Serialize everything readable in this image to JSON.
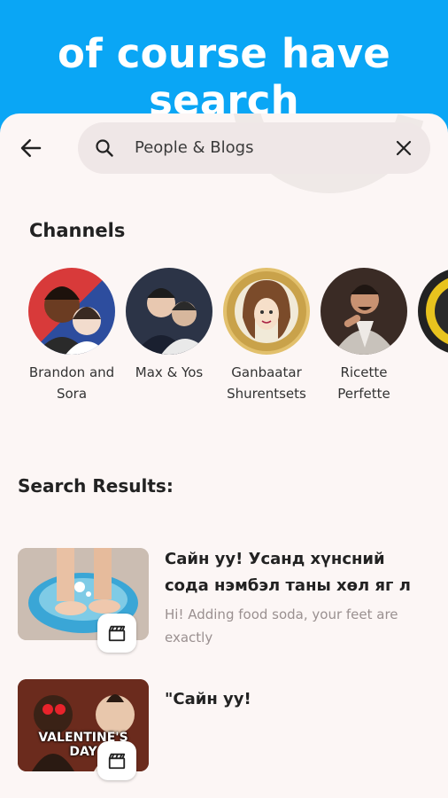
{
  "banner": {
    "title": "of course have search"
  },
  "search": {
    "query": "People & Blogs"
  },
  "channels": {
    "heading": "Channels",
    "items": [
      {
        "name": "Brandon and Sora"
      },
      {
        "name": "Max & Yos"
      },
      {
        "name": "Ganbaatar Shurentsets"
      },
      {
        "name": "Ricette Perfette"
      }
    ]
  },
  "results": {
    "heading": "Search Results:",
    "items": [
      {
        "title": "Сайн уу! Усанд хүнсний сода нэмбэл таны хөл яг л",
        "subtitle": "Hi! Adding food soda, your feet are exactly"
      },
      {
        "title": "\"Сайн уу!",
        "thumb_text": "VALENTINE'S DAY"
      }
    ]
  },
  "colors": {
    "banner": "#0aa6f5",
    "background": "#fcf6f5",
    "search_field": "#efe7e7"
  },
  "icons": {
    "back": "arrow-left-icon",
    "search": "search-icon",
    "clear": "close-icon",
    "badge": "clapperboard-icon"
  }
}
